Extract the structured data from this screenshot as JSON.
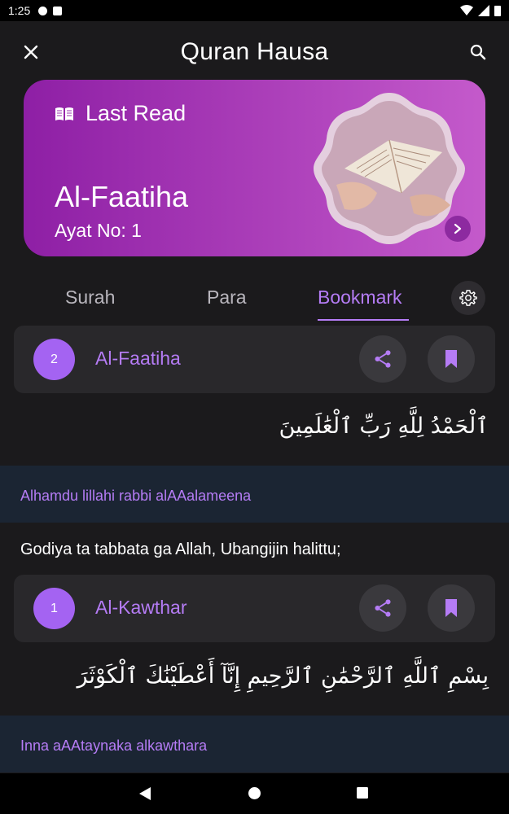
{
  "status": {
    "time": "1:25"
  },
  "appbar": {
    "title": "Quran Hausa"
  },
  "last_read": {
    "label": "Last Read",
    "surah": "Al-Faatiha",
    "ayat": "Ayat No: 1"
  },
  "tabs": [
    {
      "label": "Surah",
      "active": false
    },
    {
      "label": "Para",
      "active": false
    },
    {
      "label": "Bookmark",
      "active": true
    }
  ],
  "bookmarks": [
    {
      "number": "2",
      "name": "Al-Faatiha",
      "arabic": "ٱلْحَمْدُ لِلَّهِ رَبِّ ٱلْعَٰلَمِينَ",
      "transliteration": "Alhamdu lillahi rabbi alAAalameena",
      "translation": "Godiya ta tabbata ga Allah, Ubangijin halittu;"
    },
    {
      "number": "1",
      "name": "Al-Kawthar",
      "arabic": "بِسْمِ ٱللَّهِ ٱلرَّحْمَٰنِ ٱلرَّحِيمِ إِنَّآ أَعْطَيْنَٰكَ ٱلْكَوْثَرَ",
      "transliteration": "Inna aAAtaynaka alkawthara"
    }
  ],
  "colors": {
    "accent": "#b57cf5",
    "card_gradient_start": "#8e1fa5",
    "card_gradient_end": "#c45acb",
    "background": "#1b1a1c",
    "translit_band": "#1b2533"
  }
}
